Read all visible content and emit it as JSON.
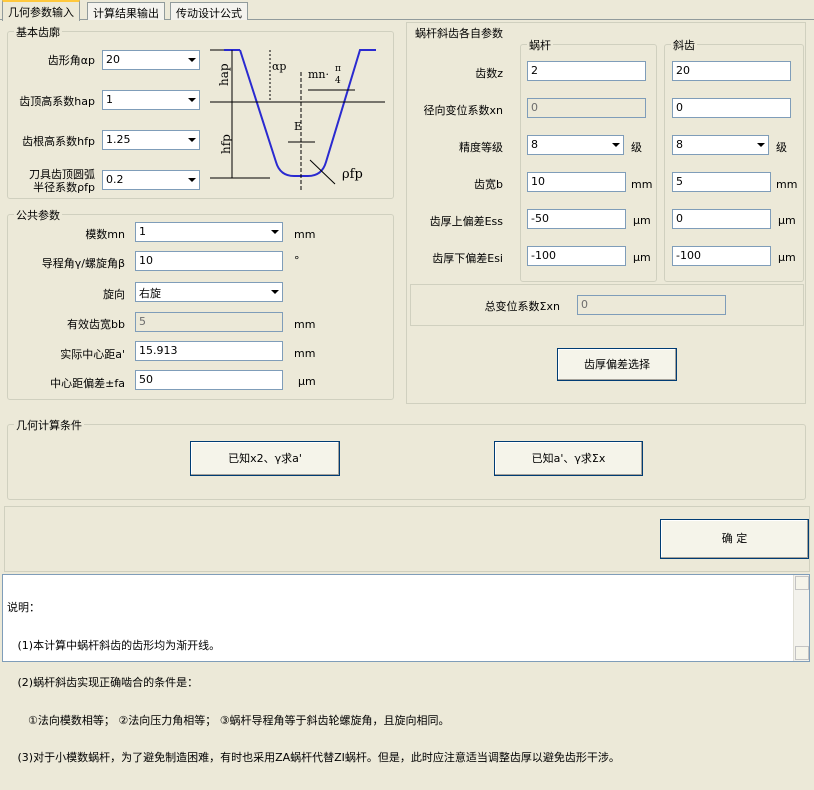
{
  "tabs": [
    "几何参数输入",
    "计算结果输出",
    "传动设计公式"
  ],
  "basic_profile": {
    "title": "基本齿廓",
    "pressure_angle_label": "齿形角αp",
    "pressure_angle_value": "20",
    "addendum_coef_label": "齿顶高系数hap",
    "addendum_coef_value": "1",
    "dedendum_coef_label": "齿根高系数hfp",
    "dedendum_coef_value": "1.25",
    "tip_radius_label_1": "刀具齿顶圆弧",
    "tip_radius_label_2": "半径系数ρfp",
    "tip_radius_value": "0.2"
  },
  "diagram": {
    "hap": "hap",
    "hfp": "hfp",
    "alpha": "αp",
    "mn": "mn·",
    "pi": "π",
    "four": "4",
    "e": "E",
    "rho": "ρfp"
  },
  "common": {
    "title": "公共参数",
    "module_label": "模数mn",
    "module_value": "1",
    "module_unit": "mm",
    "lead_angle_label": "导程角γ/螺旋角β",
    "lead_angle_value": "10",
    "lead_angle_unit": "°",
    "hand_label": "旋向",
    "hand_value": "右旋",
    "face_width_label": "有效齿宽bb",
    "face_width_value": "5",
    "face_width_unit": "mm",
    "center_label": "实际中心距a'",
    "center_value": "15.913",
    "center_unit": "mm",
    "center_dev_label": "中心距偏差±fa",
    "center_dev_value": "50",
    "center_dev_unit": "μm"
  },
  "worm_params": {
    "title": "蜗杆斜齿各自参数",
    "worm_header": "蜗杆",
    "gear_header": "斜齿",
    "teeth_label": "齿数z",
    "worm_teeth": "2",
    "gear_teeth": "20",
    "shift_label": "径向变位系数xn",
    "worm_shift": "0",
    "gear_shift": "0",
    "grade_label": "精度等级",
    "worm_grade": "8",
    "gear_grade": "8",
    "grade_unit": "级",
    "width_label": "齿宽b",
    "worm_width": "10",
    "gear_width": "5",
    "width_unit": "mm",
    "upper_label": "齿厚上偏差Ess",
    "worm_upper": "-50",
    "gear_upper": "0",
    "upper_unit": "μm",
    "lower_label": "齿厚下偏差Esi",
    "worm_lower": "-100",
    "gear_lower": "-100",
    "lower_unit": "μm",
    "total_shift_label": "总变位系数Σxn",
    "total_shift_value": "0",
    "thickness_btn": "齿厚偏差选择"
  },
  "geometry": {
    "title": "几何计算条件",
    "btn1": "已知x2、γ求a'",
    "btn2": "已知a'、γ求Σx"
  },
  "confirm": "确  定",
  "notes": {
    "l1": "说明：",
    "l2": "   (1)本计算中蜗杆斜齿的齿形均为渐开线。",
    "l3": "   (2)蜗杆斜齿实现正确啮合的条件是：",
    "l4": "      ①法向模数相等； ②法向压力角相等； ③蜗杆导程角等于斜齿轮螺旋角，且旋向相同。",
    "l5": "   (3)对于小模数蜗杆，为了避免制造困难，有时也采用ZA蜗杆代替ZI蜗杆。但是，此时应注意适当调整齿厚以避免齿形干涉。"
  }
}
